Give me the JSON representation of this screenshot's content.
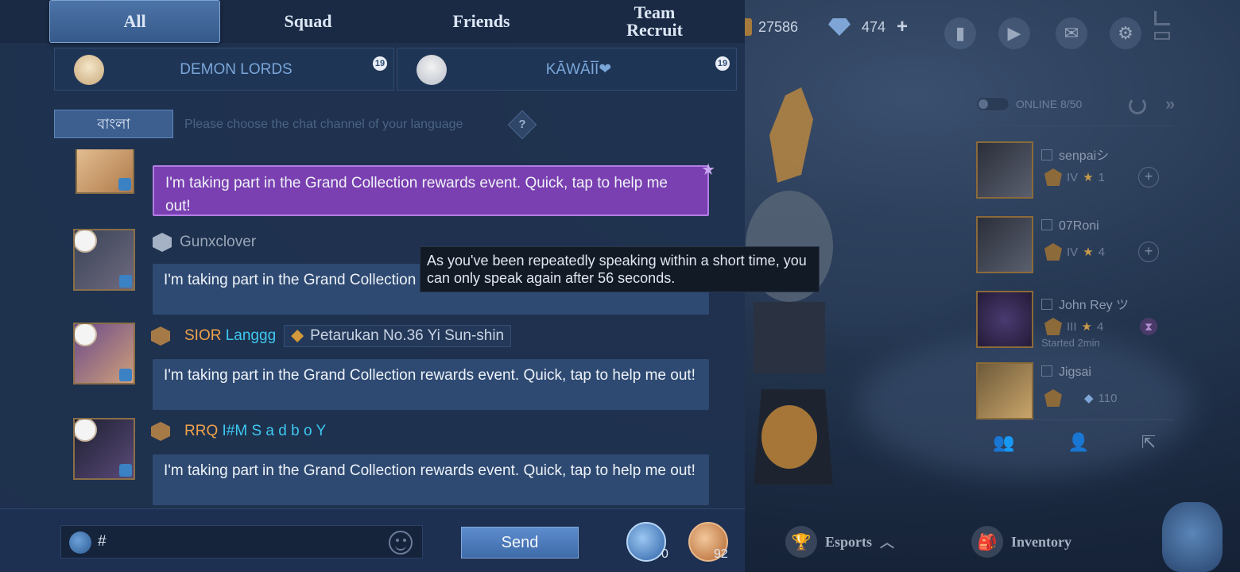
{
  "tabs": [
    {
      "label": "All",
      "active": true
    },
    {
      "label": "Squad",
      "active": false
    },
    {
      "label": "Friends",
      "active": false
    },
    {
      "label": "Team\nRecruit",
      "active": false
    }
  ],
  "pinned": [
    {
      "name": "DEMON LORDS",
      "badge": "19"
    },
    {
      "name": "KĀWĀĪĪ❤",
      "badge": "19"
    }
  ],
  "language": {
    "button": "বাংলা",
    "hint": "Please choose the chat channel of your language",
    "help": "?"
  },
  "messages": [
    {
      "sender_prefix": "",
      "sender": "",
      "hero": "",
      "text": "I'm taking part in the Grand Collection rewards event. Quick, tap to help me out!",
      "special": true
    },
    {
      "sender_prefix": "",
      "sender": "Gunxclover",
      "hero": "",
      "text": "I'm taking part in the Grand Collection rewards event. Quick, tap to help me out!",
      "special": false
    },
    {
      "sender_prefix": "SIOR",
      "sender": "Langgg",
      "hero": "Petarukan No.36 Yi Sun-shin",
      "text": "I'm taking part in the Grand Collection rewards event. Quick, tap to help me out!",
      "special": false
    },
    {
      "sender_prefix": "RRQ",
      "sender": "I#M S a d b o Y",
      "hero": "",
      "text": "I'm taking part in the Grand Collection rewards event. Quick, tap to help me out!",
      "special": false
    }
  ],
  "tooltip": "As you've been repeatedly speaking within a short time, you can only speak again after 56 seconds.",
  "input": {
    "value": "#",
    "send_label": "Send"
  },
  "horns": {
    "blue_count": "0",
    "gold_count": "92"
  },
  "currency": {
    "gold": "27586",
    "diamonds": "474",
    "plus": "+"
  },
  "online": "ONLINE 8/50",
  "friends": [
    {
      "name": "senpaiシ",
      "tier": "IV",
      "stars": "1",
      "status": ""
    },
    {
      "name": "07Roni",
      "tier": "IV",
      "stars": "4",
      "status": ""
    },
    {
      "name": "John Rey ツ",
      "tier": "III",
      "stars": "4",
      "status": "Started 2min"
    },
    {
      "name": "Jigsai",
      "tier": "",
      "stars": "",
      "status": "",
      "diamonds": "110"
    }
  ],
  "nav": {
    "esports": "Esports",
    "inventory": "Inventory"
  },
  "colors": {
    "chat_bg": "#1f324e",
    "special_bubble": "#7a3fb0",
    "name_orange": "#f0a24a",
    "name_cyan": "#3ec8f0"
  }
}
